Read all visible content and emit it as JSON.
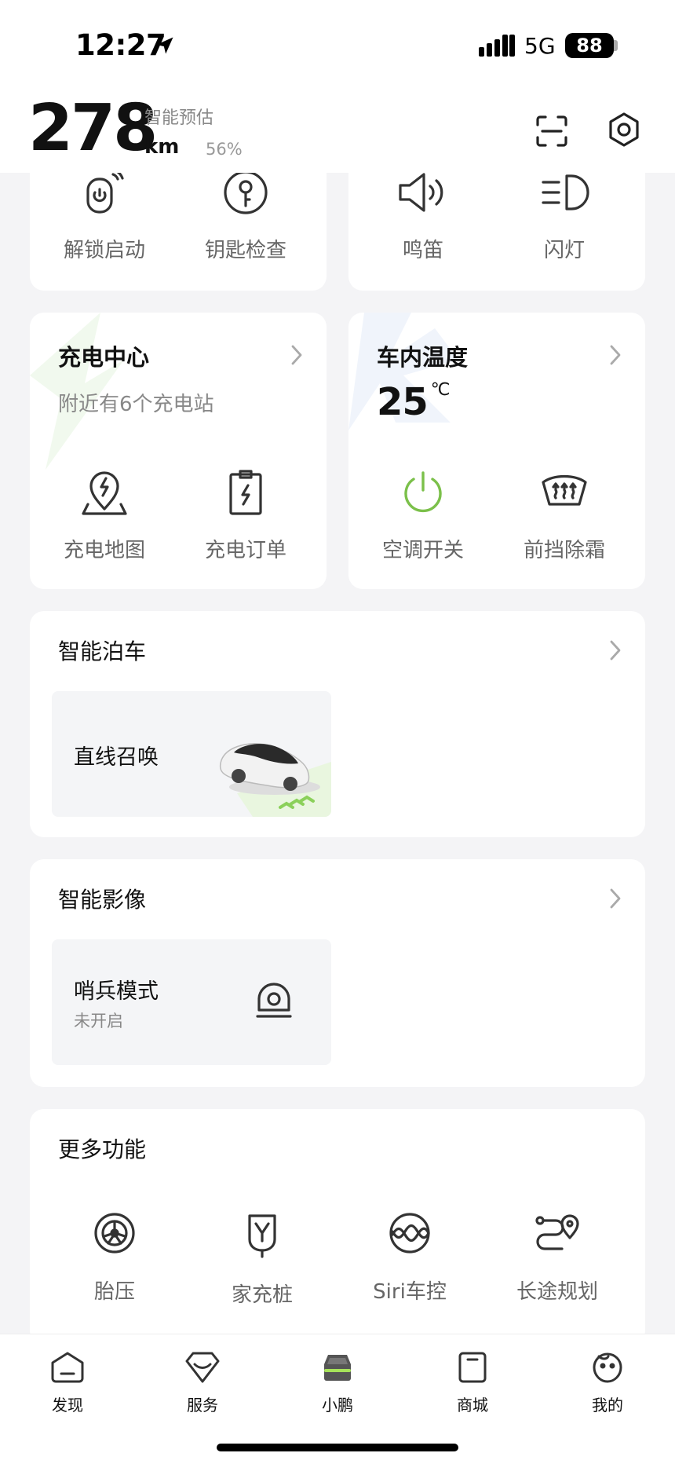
{
  "status_bar": {
    "time": "12:27",
    "network": "5G",
    "battery": "88"
  },
  "header": {
    "range": "278",
    "unit": "km",
    "estimate_label": "智能预估",
    "battery_percent": "56%"
  },
  "quick_actions": {
    "left": [
      {
        "label": "解锁启动",
        "icon": "unlock-start-icon"
      },
      {
        "label": "钥匙检查",
        "icon": "key-icon"
      }
    ],
    "right": [
      {
        "label": "鸣笛",
        "icon": "horn-icon"
      },
      {
        "label": "闪灯",
        "icon": "headlight-icon"
      }
    ]
  },
  "charging": {
    "title": "充电中心",
    "subtitle": "附近有6个充电站",
    "items": [
      {
        "label": "充电地图",
        "icon": "charging-map-icon"
      },
      {
        "label": "充电订单",
        "icon": "charging-order-icon"
      }
    ]
  },
  "cabin": {
    "title": "车内温度",
    "temperature": "25",
    "temp_unit": "℃",
    "items": [
      {
        "label": "空调开关",
        "icon": "power-icon"
      },
      {
        "label": "前挡除霜",
        "icon": "defrost-icon"
      }
    ],
    "accent": "#7bc04a"
  },
  "parking": {
    "title": "智能泊车",
    "card_title": "直线召唤"
  },
  "imaging": {
    "title": "智能影像",
    "card_title": "哨兵模式",
    "card_status": "未开启"
  },
  "more": {
    "title": "更多功能",
    "items": [
      {
        "label": "胎压",
        "icon": "tire-icon"
      },
      {
        "label": "家充桩",
        "icon": "home-charger-icon"
      },
      {
        "label": "Siri车控",
        "icon": "siri-icon"
      },
      {
        "label": "长途规划",
        "icon": "route-icon"
      }
    ]
  },
  "tabs": [
    {
      "label": "发现",
      "icon": "discover-icon"
    },
    {
      "label": "服务",
      "icon": "service-icon"
    },
    {
      "label": "小鹏",
      "icon": "car-icon",
      "active": true
    },
    {
      "label": "商城",
      "icon": "mall-icon"
    },
    {
      "label": "我的",
      "icon": "profile-icon"
    }
  ]
}
